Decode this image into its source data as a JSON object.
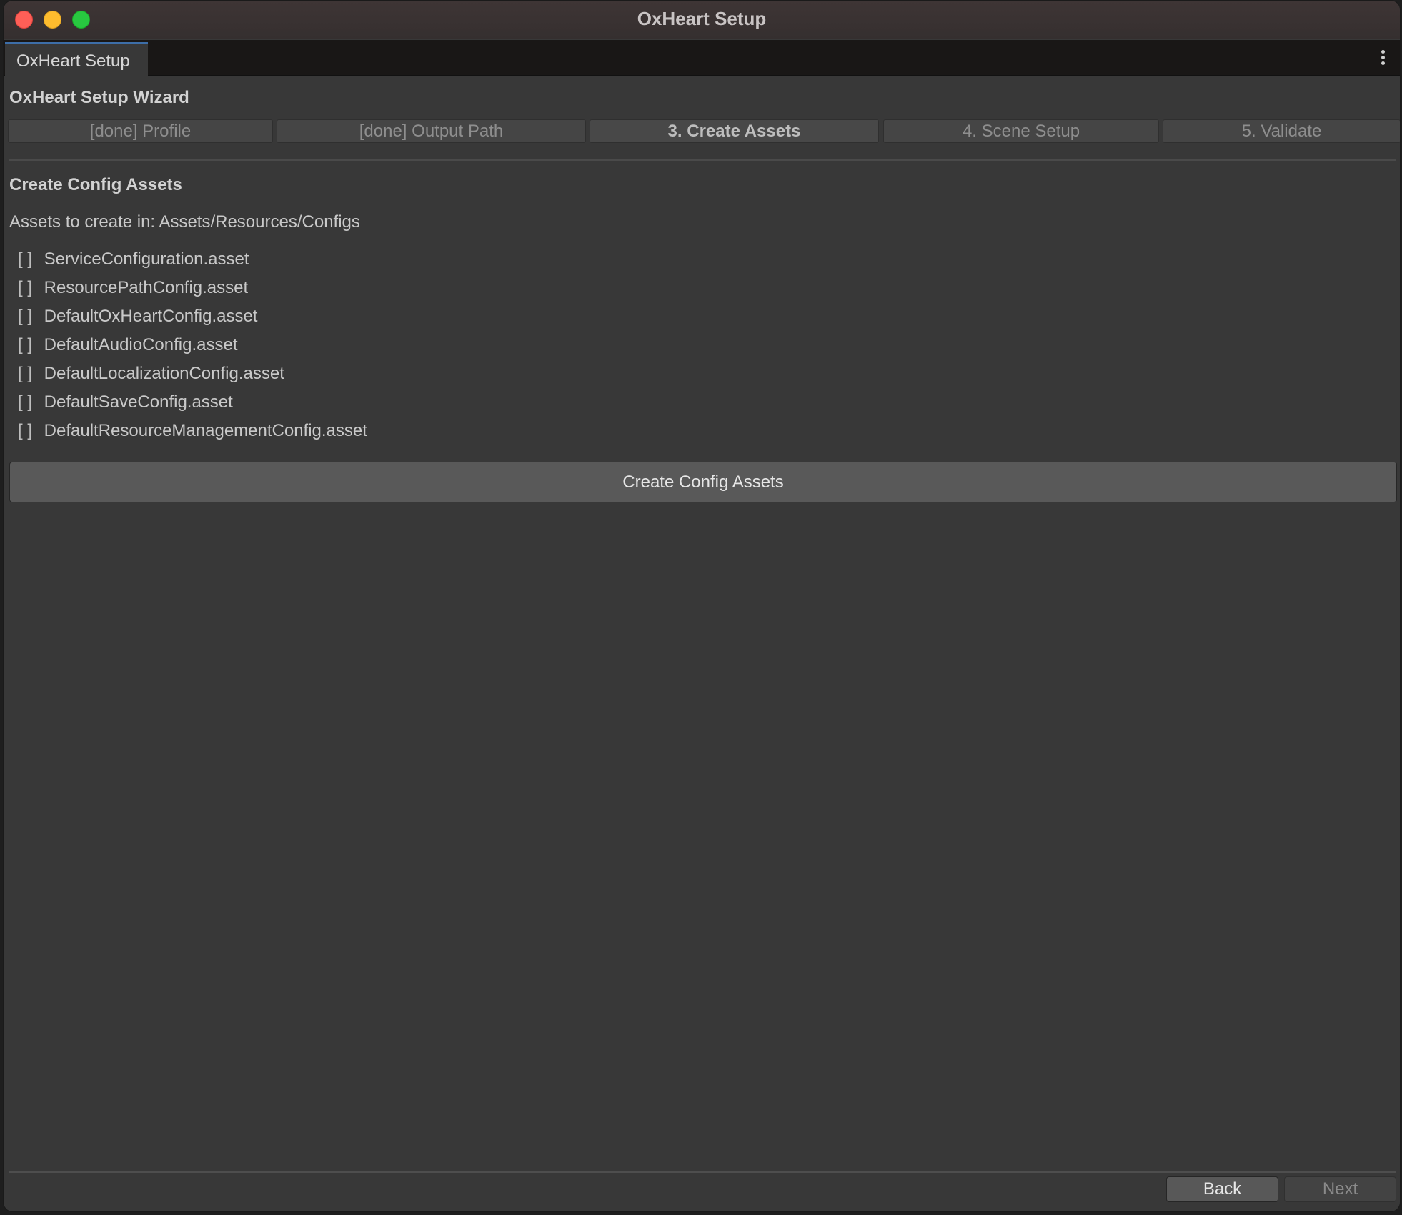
{
  "window": {
    "title": "OxHeart Setup"
  },
  "tab": {
    "label": "OxHeart Setup"
  },
  "wizard": {
    "title": "OxHeart Setup Wizard",
    "steps": [
      {
        "label": "[done] Profile",
        "state": "done"
      },
      {
        "label": "[done] Output Path",
        "state": "done"
      },
      {
        "label": "3. Create Assets",
        "state": "active"
      },
      {
        "label": "4. Scene Setup",
        "state": "pending"
      },
      {
        "label": "5. Validate",
        "state": "pending"
      }
    ]
  },
  "section": {
    "title": "Create Config Assets",
    "path_label": "Assets to create in: Assets/Resources/Configs",
    "checkbox_glyph": "[ ]",
    "assets": [
      "ServiceConfiguration.asset",
      "ResourcePathConfig.asset",
      "DefaultOxHeartConfig.asset",
      "DefaultAudioConfig.asset",
      "DefaultLocalizationConfig.asset",
      "DefaultSaveConfig.asset",
      "DefaultResourceManagementConfig.asset"
    ],
    "create_button": "Create Config Assets"
  },
  "footer": {
    "back": "Back",
    "next": "Next"
  },
  "colors": {
    "background": "#383838",
    "tab_accent": "#3d6ea8",
    "close": "#fe5f57",
    "minimize": "#febc2e",
    "maximize": "#28c840"
  },
  "icons": {
    "menu": "more-vertical-icon"
  }
}
